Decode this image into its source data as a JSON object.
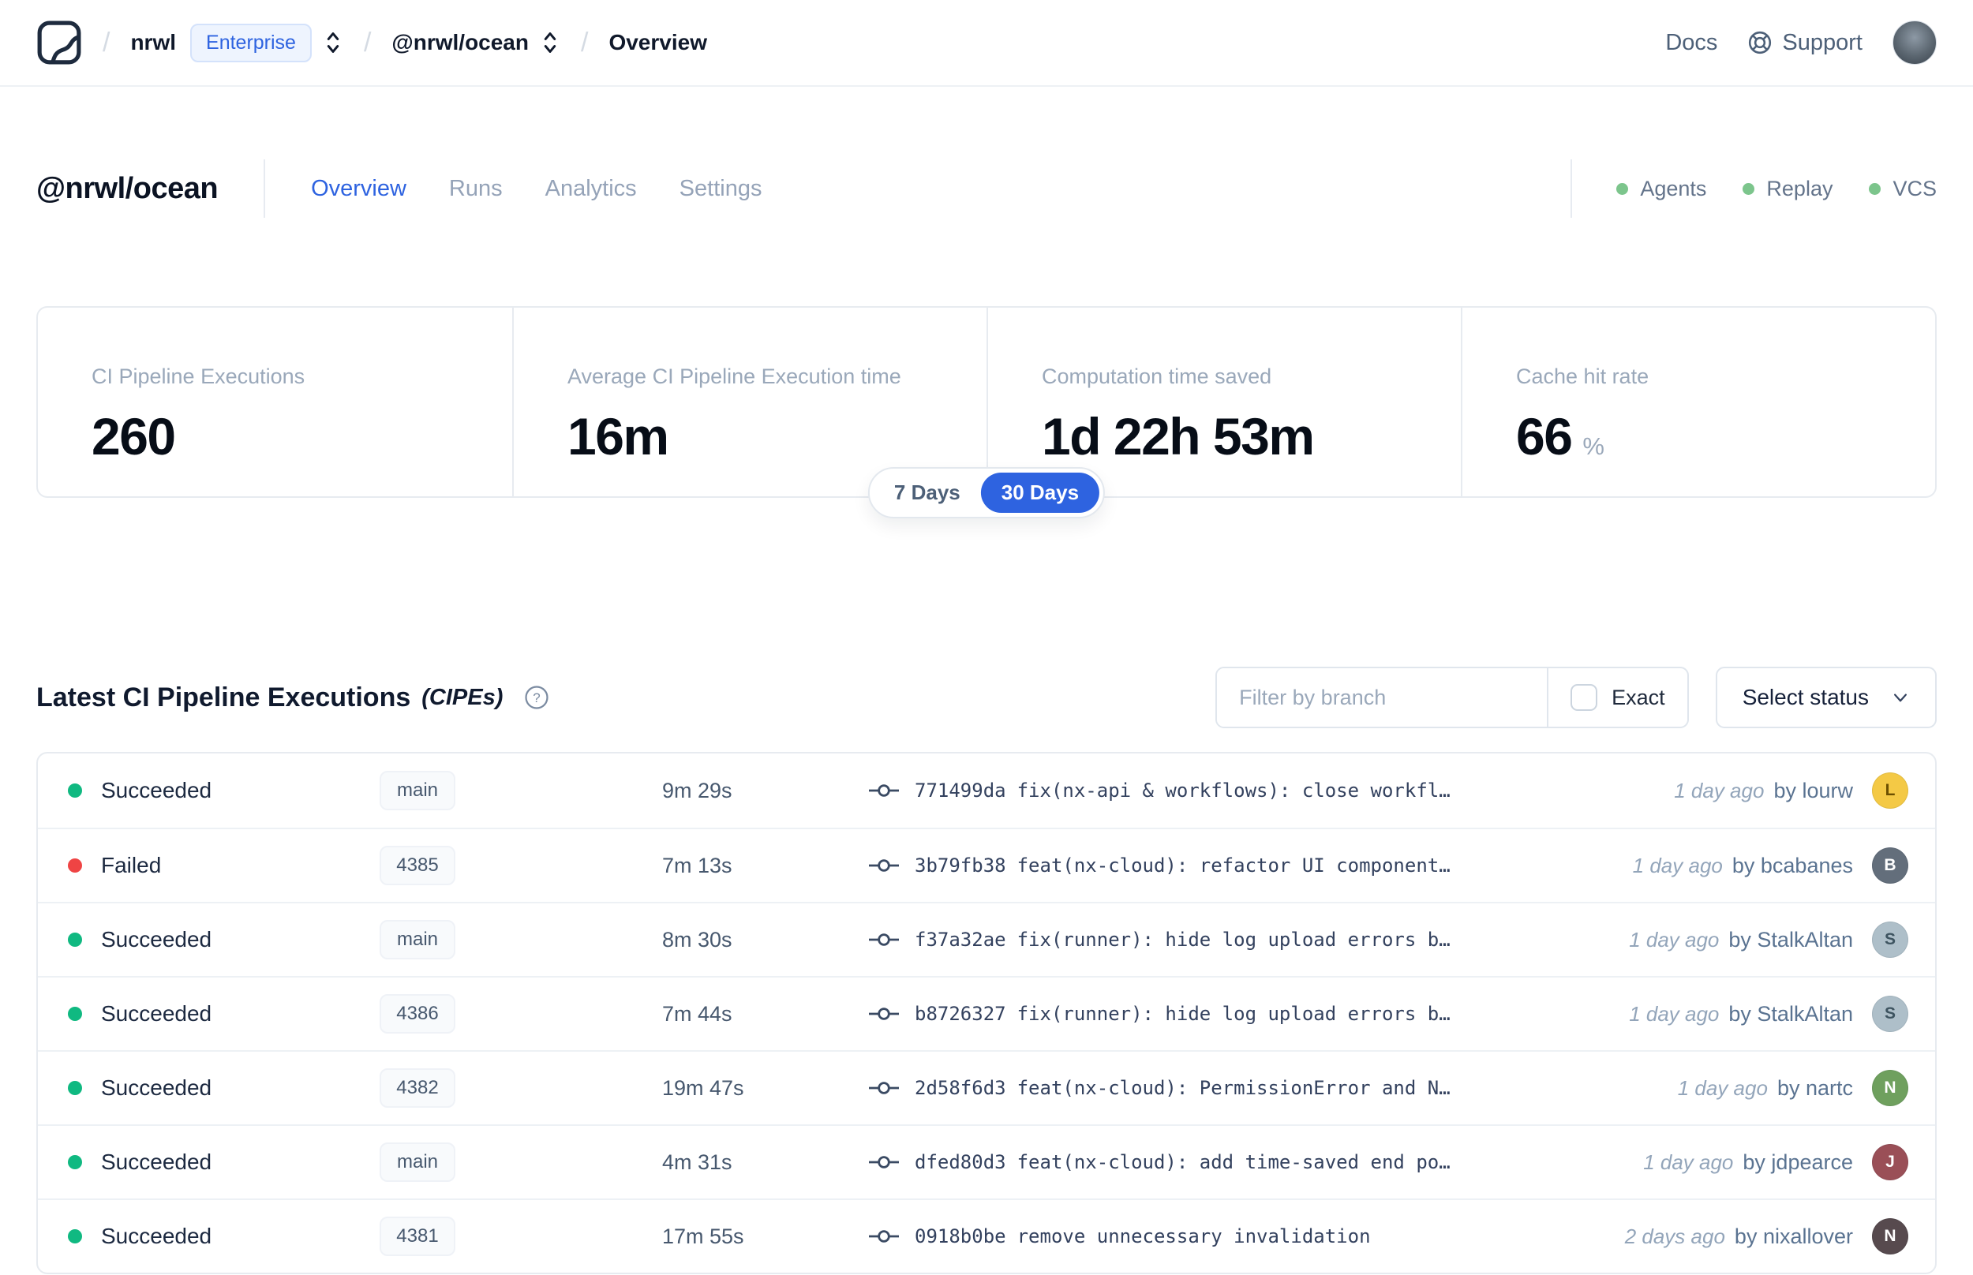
{
  "colors": {
    "accent": "#2e63e0",
    "succeeded": "#10b981",
    "failed": "#ef4444",
    "health_dot": "#7cc58c"
  },
  "navbar": {
    "breadcrumb": {
      "org": "nrwl",
      "org_badge": "Enterprise",
      "project": "@nrwl/ocean",
      "page": "Overview"
    },
    "docs_label": "Docs",
    "support_label": "Support"
  },
  "header": {
    "title": "@nrwl/ocean",
    "tabs": [
      {
        "label": "Overview",
        "active": true
      },
      {
        "label": "Runs",
        "active": false
      },
      {
        "label": "Analytics",
        "active": false
      },
      {
        "label": "Settings",
        "active": false
      }
    ],
    "statuses": [
      {
        "label": "Agents"
      },
      {
        "label": "Replay"
      },
      {
        "label": "VCS"
      }
    ]
  },
  "stats": {
    "cards": [
      {
        "label": "CI Pipeline Executions",
        "value": "260"
      },
      {
        "label": "Average CI Pipeline Execution time",
        "value": "16m"
      },
      {
        "label": "Computation time saved",
        "value": "1d 22h 53m"
      },
      {
        "label": "Cache hit rate",
        "value": "66",
        "suffix": "%"
      }
    ],
    "range_toggle": {
      "options": [
        "7 Days",
        "30 Days"
      ],
      "selected": "30 Days"
    }
  },
  "section": {
    "title": "Latest CI Pipeline Executions",
    "subtitle": "(CIPEs)",
    "filter_placeholder": "Filter by branch",
    "exact_label": "Exact",
    "exact_checked": false,
    "status_dropdown_label": "Select status"
  },
  "table": {
    "rows": [
      {
        "status": "Succeeded",
        "status_color": "#10b981",
        "branch": "main",
        "duration": "9m 29s",
        "commit_hash": "771499da",
        "commit_message": "fix(nx-api & workflows): close workfl…",
        "time_ago": "1 day ago",
        "author_label": "by lourw",
        "avatar": {
          "initial": "L",
          "bg": "#f4c945",
          "fg": "#6b4f00"
        }
      },
      {
        "status": "Failed",
        "status_color": "#ef4444",
        "branch": "4385",
        "duration": "7m 13s",
        "commit_hash": "3b79fb38",
        "commit_message": "feat(nx-cloud): refactor UI component…",
        "time_ago": "1 day ago",
        "author_label": "by bcabanes",
        "avatar": {
          "initial": "B",
          "bg": "#636e7b",
          "fg": "#ffffff"
        }
      },
      {
        "status": "Succeeded",
        "status_color": "#10b981",
        "branch": "main",
        "duration": "8m 30s",
        "commit_hash": "f37a32ae",
        "commit_message": "fix(runner): hide log upload errors b…",
        "time_ago": "1 day ago",
        "author_label": "by StalkAltan",
        "avatar": {
          "initial": "S",
          "bg": "#aebfc9",
          "fg": "#3e5460"
        }
      },
      {
        "status": "Succeeded",
        "status_color": "#10b981",
        "branch": "4386",
        "duration": "7m 44s",
        "commit_hash": "b8726327",
        "commit_message": "fix(runner): hide log upload errors b…",
        "time_ago": "1 day ago",
        "author_label": "by StalkAltan",
        "avatar": {
          "initial": "S",
          "bg": "#aebfc9",
          "fg": "#3e5460"
        }
      },
      {
        "status": "Succeeded",
        "status_color": "#10b981",
        "branch": "4382",
        "duration": "19m 47s",
        "commit_hash": "2d58f6d3",
        "commit_message": "feat(nx-cloud): PermissionError and N…",
        "time_ago": "1 day ago",
        "author_label": "by nartc",
        "avatar": {
          "initial": "N",
          "bg": "#6fa05e",
          "fg": "#ffffff"
        }
      },
      {
        "status": "Succeeded",
        "status_color": "#10b981",
        "branch": "main",
        "duration": "4m 31s",
        "commit_hash": "dfed80d3",
        "commit_message": "feat(nx-cloud): add time-saved end po…",
        "time_ago": "1 day ago",
        "author_label": "by jdpearce",
        "avatar": {
          "initial": "J",
          "bg": "#9a4f57",
          "fg": "#ffffff"
        }
      },
      {
        "status": "Succeeded",
        "status_color": "#10b981",
        "branch": "4381",
        "duration": "17m 55s",
        "commit_hash": "0918b0be",
        "commit_message": "remove unnecessary invalidation",
        "time_ago": "2 days ago",
        "author_label": "by nixallover",
        "avatar": {
          "initial": "N",
          "bg": "#574a4e",
          "fg": "#ffffff"
        }
      }
    ]
  }
}
